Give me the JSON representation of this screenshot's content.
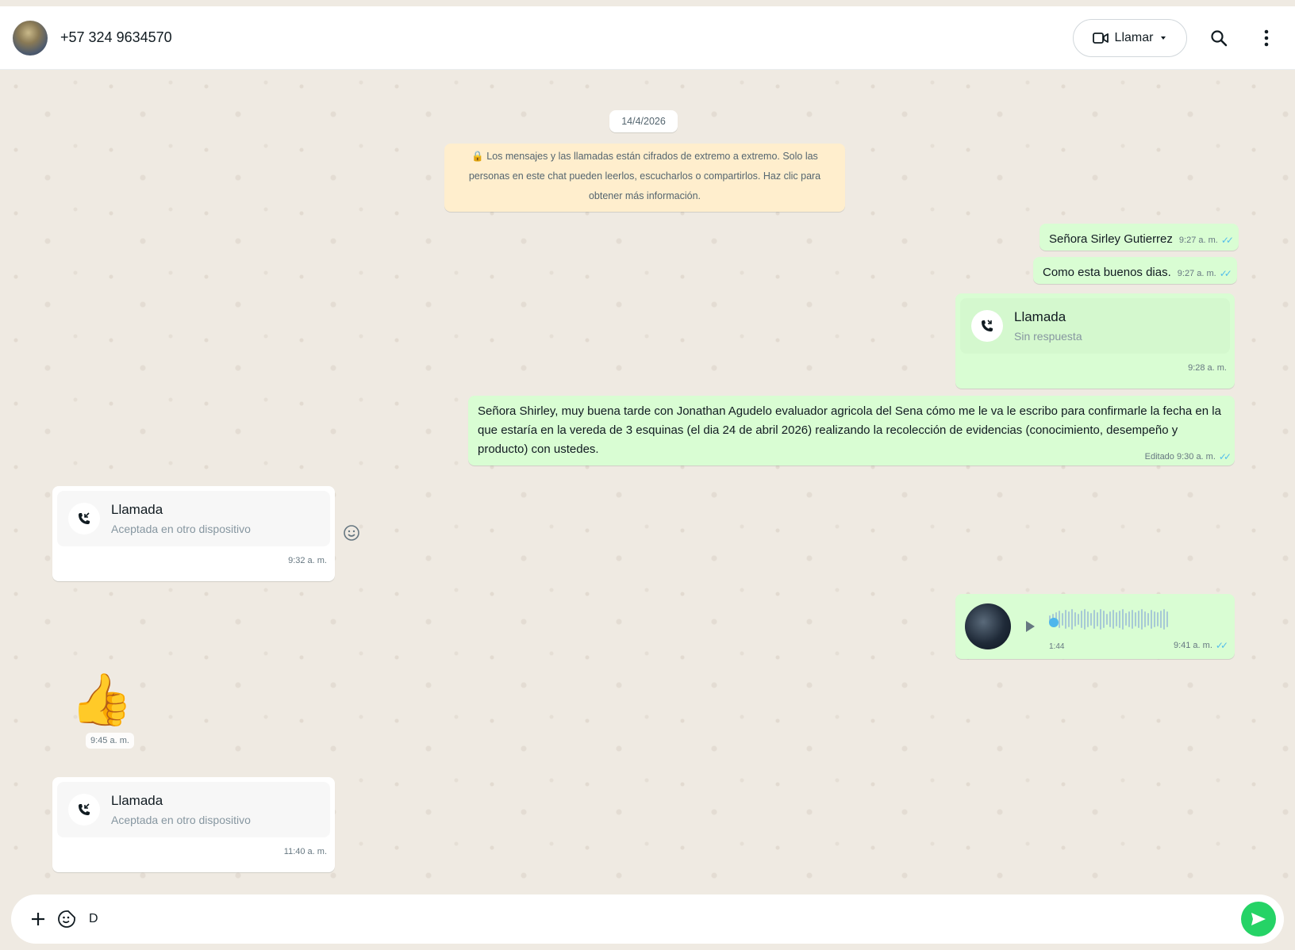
{
  "header": {
    "contact_name": "+57 324 9634570",
    "call_label": "Llamar",
    "icons": [
      "video-icon",
      "chevron-down-icon",
      "search-icon",
      "menu-dots-icon"
    ]
  },
  "chat": {
    "date_chip": "14/4/2026",
    "encryption_notice": "Los mensajes y las llamadas están cifrados de extremo a extremo. Solo las personas en este chat pueden leerlos, escucharlos o compartirlos. Haz clic para obtener más información.",
    "messages": [
      {
        "text": "Señora Sirley Gutierrez",
        "time": "9:27 a. m."
      },
      {
        "text": "Como esta buenos dias.",
        "time": "9:27 a. m."
      },
      {
        "call_title": "Llamada",
        "call_sub": "Sin respuesta",
        "time": "9:28 a. m."
      },
      {
        "text": "Señora Shirley, muy buena tarde con Jonathan Agudelo evaluador agricola del Sena cómo me le va le escribo para confirmarle la fecha en la que estaría en la vereda de 3 esquinas (el dia 24 de abril 2026) realizando la recolección de evidencias (conocimiento, desempeño y producto) con ustedes.",
        "time": "Editado 9:30 a. m."
      },
      {
        "call_title": "Llamada",
        "call_sub": "Aceptada en otro dispositivo",
        "time": "9:32 a. m."
      },
      {
        "voice_duration": "1:44",
        "time": "9:41 a. m."
      },
      {
        "emoji": "👍",
        "time": "9:45 a. m."
      },
      {
        "call_title": "Llamada",
        "call_sub": "Aceptada en otro dispositivo",
        "time": "11:40 a. m."
      }
    ]
  },
  "composer": {
    "input_value": "D"
  },
  "colors": {
    "outgoing_bubble": "#d9fdd3",
    "incoming_bubble": "#ffffff",
    "accent": "#25d366",
    "read_ticks": "#53bdeb"
  }
}
